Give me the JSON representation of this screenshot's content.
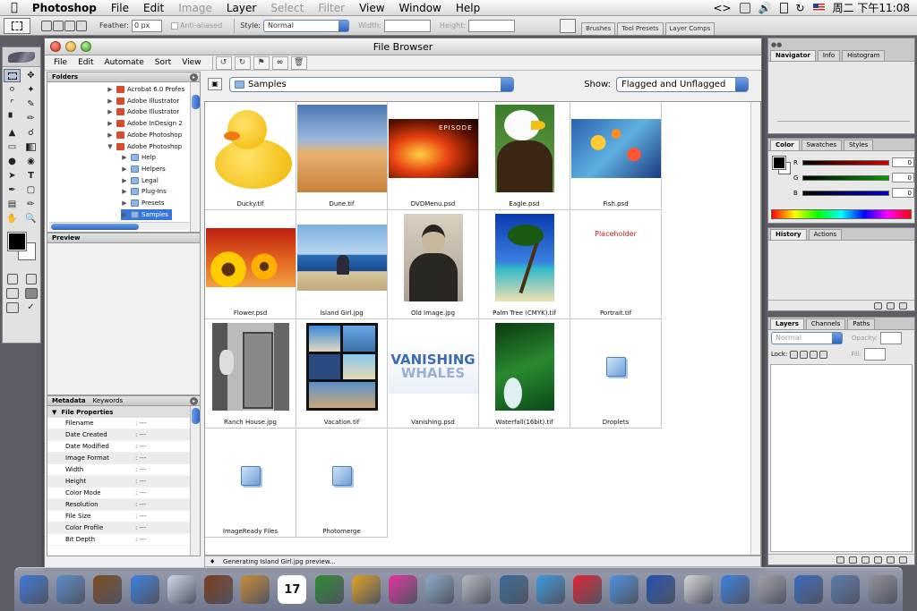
{
  "menubar": {
    "app_name": "Photoshop",
    "items": [
      {
        "label": "File",
        "enabled": true
      },
      {
        "label": "Edit",
        "enabled": true
      },
      {
        "label": "Image",
        "enabled": false
      },
      {
        "label": "Layer",
        "enabled": true
      },
      {
        "label": "Select",
        "enabled": false
      },
      {
        "label": "Filter",
        "enabled": false
      },
      {
        "label": "View",
        "enabled": true
      },
      {
        "label": "Window",
        "enabled": true
      },
      {
        "label": "Help",
        "enabled": true
      }
    ],
    "status": {
      "arrows": "<>",
      "clock": "周二 下午11:08"
    }
  },
  "options_bar": {
    "feather_label": "Feather:",
    "feather_value": "0 px",
    "anti_aliased_label": "Anti-aliased",
    "style_label": "Style:",
    "style_value": "Normal",
    "width_label": "Width:",
    "height_label": "Height:",
    "palette_tabs": [
      "Brushes",
      "Tool Presets",
      "Layer Comps"
    ]
  },
  "file_browser": {
    "title": "File Browser",
    "menu": [
      "File",
      "Edit",
      "Automate",
      "Sort",
      "View"
    ],
    "panels": {
      "folders": "Folders",
      "preview": "Preview",
      "metadata": "Metadata",
      "keywords": "Keywords"
    },
    "folders": [
      {
        "label": "Acrobat 6.0 Profes",
        "depth": 0,
        "expanded": false,
        "kind": "app",
        "selected": false
      },
      {
        "label": "Adobe Illustrator",
        "depth": 0,
        "expanded": false,
        "kind": "app",
        "selected": false
      },
      {
        "label": "Adobe Illustrator",
        "depth": 0,
        "expanded": false,
        "kind": "app",
        "selected": false
      },
      {
        "label": "Adobe InDesign 2",
        "depth": 0,
        "expanded": false,
        "kind": "app",
        "selected": false
      },
      {
        "label": "Adobe Photoshop",
        "depth": 0,
        "expanded": false,
        "kind": "app",
        "selected": false
      },
      {
        "label": "Adobe Photoshop",
        "depth": 0,
        "expanded": true,
        "kind": "app",
        "selected": false
      },
      {
        "label": "Help",
        "depth": 1,
        "expanded": false,
        "kind": "folder",
        "selected": false
      },
      {
        "label": "Helpers",
        "depth": 1,
        "expanded": false,
        "kind": "folder",
        "selected": false
      },
      {
        "label": "Legal",
        "depth": 1,
        "expanded": false,
        "kind": "folder",
        "selected": false
      },
      {
        "label": "Plug-Ins",
        "depth": 1,
        "expanded": false,
        "kind": "folder",
        "selected": false
      },
      {
        "label": "Presets",
        "depth": 1,
        "expanded": false,
        "kind": "folder",
        "selected": false
      },
      {
        "label": "Samples",
        "depth": 1,
        "expanded": false,
        "kind": "folder",
        "selected": true
      }
    ],
    "metadata_section": "File Properties",
    "metadata": [
      {
        "key": "Filename",
        "value": ": ---"
      },
      {
        "key": "Date Created",
        "value": ": ---"
      },
      {
        "key": "Date Modified",
        "value": ": ---"
      },
      {
        "key": "Image Format",
        "value": ": ---"
      },
      {
        "key": "Width",
        "value": ": ---"
      },
      {
        "key": "Height",
        "value": ": ---"
      },
      {
        "key": "Color Mode",
        "value": ": ---"
      },
      {
        "key": "Resolution",
        "value": ": ---"
      },
      {
        "key": "File Size",
        "value": ": ---"
      },
      {
        "key": "Color Profile",
        "value": ": ---"
      },
      {
        "key": "Bit Depth",
        "value": ": ---"
      }
    ],
    "location": "Samples",
    "show_label": "Show:",
    "show_value": "Flagged and Unflagged",
    "files": [
      {
        "name": "Ducky.tif",
        "thumb": "duck"
      },
      {
        "name": "Dune.tif",
        "thumb": "dune"
      },
      {
        "name": "DVDMenu.psd",
        "thumb": "dvd"
      },
      {
        "name": "Eagle.psd",
        "thumb": "eagle"
      },
      {
        "name": "Fish.psd",
        "thumb": "fish"
      },
      {
        "name": "Flower.psd",
        "thumb": "flower"
      },
      {
        "name": "Island Girl.jpg",
        "thumb": "island"
      },
      {
        "name": "Old Image.jpg",
        "thumb": "oldimage"
      },
      {
        "name": "Palm Tree (CMYK).tif",
        "thumb": "palm"
      },
      {
        "name": "Portrait.tif",
        "thumb": "placeholder"
      },
      {
        "name": "Ranch House.jpg",
        "thumb": "ranch"
      },
      {
        "name": "Vacation.tif",
        "thumb": "vacation"
      },
      {
        "name": "Vanishing.psd",
        "thumb": "vanishing"
      },
      {
        "name": "Waterfall(16bit).tif",
        "thumb": "waterfall"
      },
      {
        "name": "Droplets",
        "thumb": "folder"
      },
      {
        "name": "ImageReady Files",
        "thumb": "folder"
      },
      {
        "name": "Photomerge",
        "thumb": "folder"
      }
    ],
    "thumb_text": {
      "dvd": "EPISODE",
      "placeholder": "Placeholder",
      "vanishing_top": "VANISHING",
      "vanishing_bottom": "WHALES"
    },
    "status": "Generating Island Girl.jpg preview..."
  },
  "palettes": {
    "navigator_tabs": [
      "Navigator",
      "Info",
      "Histogram"
    ],
    "color_tabs": [
      "Color",
      "Swatches",
      "Styles"
    ],
    "color_channels": [
      {
        "label": "R",
        "value": "0",
        "color": "#d00000"
      },
      {
        "label": "G",
        "value": "0",
        "color": "#00a000"
      },
      {
        "label": "B",
        "value": "0",
        "color": "#0000c0"
      }
    ],
    "history_tabs": [
      "History",
      "Actions"
    ],
    "layers_tabs": [
      "Layers",
      "Channels",
      "Paths"
    ],
    "blend_mode": "Normal",
    "opacity_label": "Opacity:",
    "lock_label": "Lock:",
    "fill_label": "Fill:"
  },
  "dock": {
    "items": [
      "finder-icon",
      "mail-stamp-icon",
      "preview-icon",
      "safari-icon",
      "itunes-icon",
      "iphoto-icon",
      "address-book-icon",
      "ical-icon",
      "pencil-icon",
      "brush-icon",
      "flower-icon",
      "network-icon",
      "mac-icon",
      "camera-icon",
      "ichat-icon",
      "heart-icon",
      "wave-icon",
      "globe-icon",
      "document-icon",
      "number-one-icon",
      "cube-icon",
      "sphere-icon",
      "window-icon",
      "trash-icon"
    ],
    "calendar_day": "17"
  }
}
